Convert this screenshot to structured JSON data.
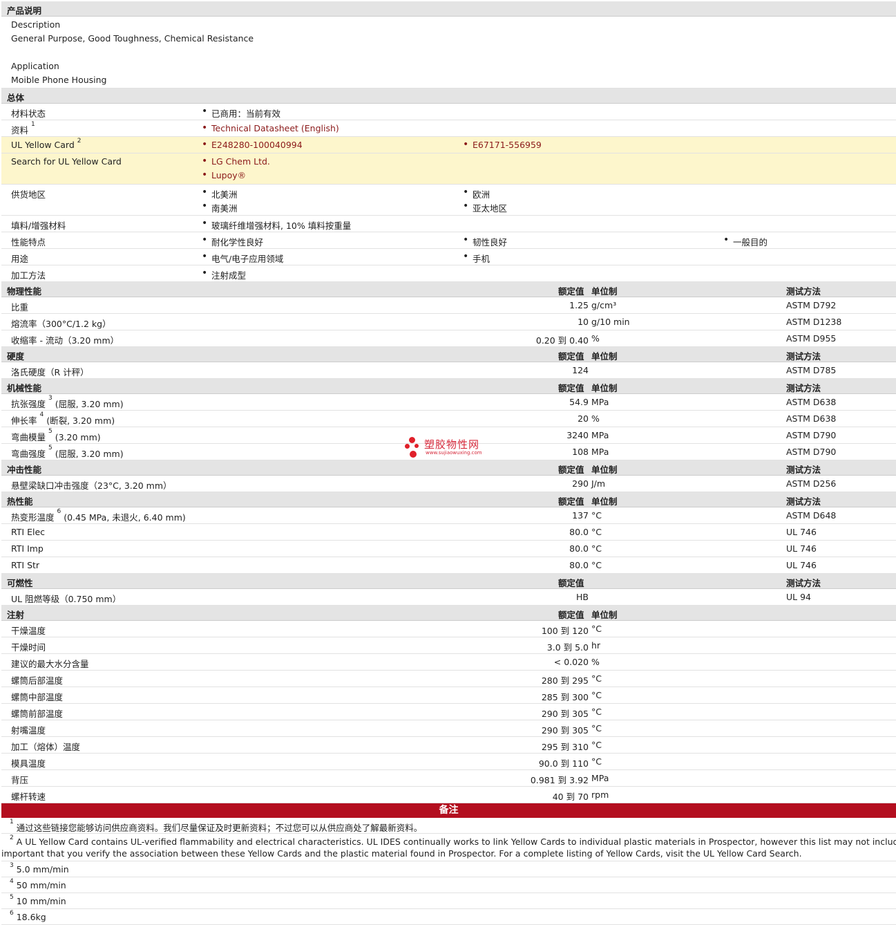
{
  "sections": {
    "desc": "产品说明",
    "general": "总体",
    "physical": "物理性能",
    "hardness": "硬度",
    "mechanical": "机械性能",
    "impact": "冲击性能",
    "thermal": "热性能",
    "flammability": "可燃性",
    "injection": "注射",
    "notes": "备注"
  },
  "cols": {
    "nominal": "额定值",
    "unit": "单位制",
    "method": "测试方法"
  },
  "description": {
    "label": "Description",
    "text": "General Purpose, Good Toughness, Chemical Resistance",
    "app_label": "Application",
    "app_text": "Moible Phone Housing"
  },
  "general": {
    "status_label": "材料状态",
    "status": "已商用：当前有效",
    "docs_label": "资料",
    "docs_sup": "1",
    "docs_link": "Technical Datasheet (English)",
    "ul_label": "UL Yellow Card",
    "ul_sup": "2",
    "ul_link1": "E248280-100040994",
    "ul_link2": "E67171-556959",
    "search_label": "Search for UL Yellow Card",
    "search_link1": "LG Chem Ltd.",
    "search_link2": "Lupoy®",
    "region_label": "供货地区",
    "region1": "北美洲",
    "region2": "欧洲",
    "region3": "南美洲",
    "region4": "亚太地区",
    "filler_label": "填料/增强材料",
    "filler": "玻璃纤维增强材料, 10% 填料按重量",
    "feature_label": "性能特点",
    "feature1": "耐化学性良好",
    "feature2": "韧性良好",
    "feature3": "一般目的",
    "use_label": "用途",
    "use1": "电气/电子应用领域",
    "use2": "手机",
    "proc_label": "加工方法",
    "proc1": "注射成型"
  },
  "physical_rows": [
    {
      "label": "比重",
      "value": "1.25",
      "unit": "g/cm³",
      "method": "ASTM D792"
    },
    {
      "label": "熔流率（300°C/1.2 kg）",
      "value": "10",
      "unit": "g/10 min",
      "method": "ASTM D1238"
    },
    {
      "label": "收缩率 - 流动（3.20 mm）",
      "value": "0.20 到  0.40",
      "unit": "%",
      "method": "ASTM D955"
    }
  ],
  "hardness_rows": [
    {
      "label": "洛氏硬度（R 计秤）",
      "value": "124",
      "unit": "",
      "method": "ASTM D785"
    }
  ],
  "mechanical_rows": [
    {
      "label": "抗张强度",
      "sup": "3",
      "label2": "(屈服, 3.20 mm)",
      "value": "54.9",
      "unit": "MPa",
      "method": "ASTM D638"
    },
    {
      "label": "伸长率",
      "sup": "4",
      "label2": "(断裂, 3.20 mm)",
      "value": "20",
      "unit": "%",
      "method": "ASTM D638"
    },
    {
      "label": "弯曲模量",
      "sup": "5",
      "label2": "(3.20 mm)",
      "value": "3240",
      "unit": "MPa",
      "method": "ASTM D790"
    },
    {
      "label": "弯曲强度",
      "sup": "5",
      "label2": "(屈服, 3.20 mm)",
      "value": "108",
      "unit": "MPa",
      "method": "ASTM D790"
    }
  ],
  "impact_rows": [
    {
      "label": "悬壁梁缺口冲击强度（23°C, 3.20 mm）",
      "value": "290",
      "unit": "J/m",
      "method": "ASTM D256"
    }
  ],
  "thermal_rows": [
    {
      "label": "热变形温度",
      "sup": "6",
      "label2": "(0.45 MPa, 未退火, 6.40 mm)",
      "value": "137",
      "unit": "°C",
      "method": "ASTM D648"
    },
    {
      "label": "RTI Elec",
      "sup": "",
      "label2": "",
      "value": "80.0",
      "unit": "°C",
      "method": "UL 746"
    },
    {
      "label": "RTI Imp",
      "sup": "",
      "label2": "",
      "value": "80.0",
      "unit": "°C",
      "method": "UL 746"
    },
    {
      "label": "RTI Str",
      "sup": "",
      "label2": "",
      "value": "80.0",
      "unit": "°C",
      "method": "UL 746"
    }
  ],
  "flammability_rows": [
    {
      "label": "UL 阻燃等级（0.750 mm）",
      "value": "HB",
      "unit": "",
      "method": "UL 94"
    }
  ],
  "injection_rows": [
    {
      "label": "干燥温度",
      "value": "100 到  120",
      "unit": "°C"
    },
    {
      "label": "干燥时间",
      "value": "3.0 到  5.0",
      "unit": "hr"
    },
    {
      "label": "建议的最大水分含量",
      "value": "< 0.020",
      "unit": "%"
    },
    {
      "label": "螺筒后部温度",
      "value": "280 到  295",
      "unit": "°C"
    },
    {
      "label": "螺筒中部温度",
      "value": "285 到  300",
      "unit": "°C"
    },
    {
      "label": "螺筒前部温度",
      "value": "290 到  305",
      "unit": "°C"
    },
    {
      "label": "射嘴温度",
      "value": "290 到  305",
      "unit": "°C"
    },
    {
      "label": "加工（熔体）温度",
      "value": "295 到  310",
      "unit": "°C"
    },
    {
      "label": "模具温度",
      "value": "90.0 到  110",
      "unit": "°C"
    },
    {
      "label": "背压",
      "value": "0.981 到  3.92",
      "unit": "MPa"
    },
    {
      "label": "螺杆转速",
      "value": "40 到  70",
      "unit": "rpm"
    }
  ],
  "notes": [
    {
      "sup": "1",
      "text": "通过这些链接您能够访问供应商资料。我们尽量保证及时更新资料；不过您可以从供应商处了解最新资料。"
    },
    {
      "sup": "2",
      "text": "A UL Yellow Card contains UL-verified flammability and electrical characteristics. UL IDES continually works to link Yellow Cards to individual plastic materials in Prospector, however this list may not include all of the appr",
      "text2": "important that you verify the association between these Yellow Cards and the plastic material found in Prospector. For a complete listing of Yellow Cards, visit the UL Yellow Card Search."
    },
    {
      "sup": "3",
      "text": "5.0 mm/min"
    },
    {
      "sup": "4",
      "text": "50 mm/min"
    },
    {
      "sup": "5",
      "text": "10 mm/min"
    },
    {
      "sup": "6",
      "text": "18.6kg"
    }
  ],
  "watermark": {
    "name": "塑胶物性网",
    "url": "www.sujiaowuxing.com"
  }
}
